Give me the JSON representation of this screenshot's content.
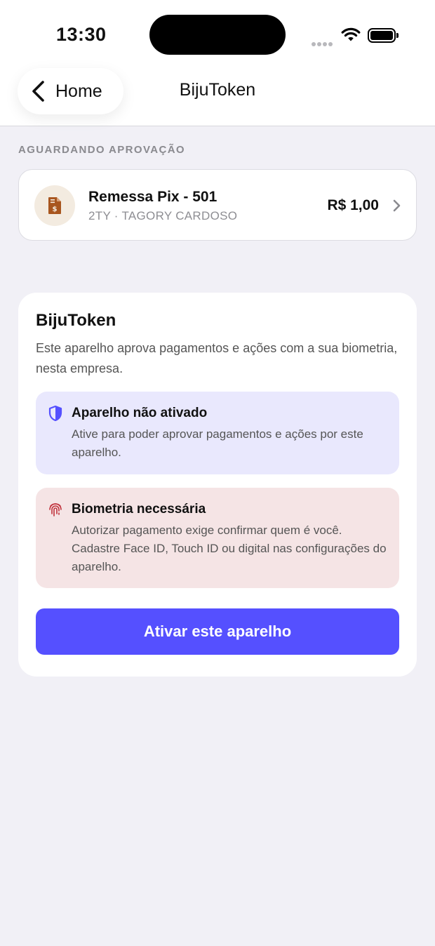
{
  "status_bar": {
    "time": "13:30"
  },
  "nav": {
    "back_label": "Home",
    "title": "BijuToken"
  },
  "pending": {
    "section_label": "AGUARDANDO APROVAÇÃO",
    "item": {
      "title": "Remessa Pix - 501",
      "subtitle": "2TY · TAGORY CARDOSO",
      "amount": "R$ 1,00"
    }
  },
  "token_card": {
    "title": "BijuToken",
    "description": "Este aparelho aprova pagamentos e ações com a sua biometria, nesta empresa.",
    "alerts": [
      {
        "title": "Aparelho não ativado",
        "text": "Ative para poder aprovar pagamentos e ações por este aparelho.",
        "icon": "shield-icon"
      },
      {
        "title": "Biometria necessária",
        "text": "Autorizar pagamento exige confirmar quem é você. Cadastre Face ID, Touch ID ou digital nas configurações do aparelho.",
        "icon": "fingerprint-icon"
      }
    ],
    "button_label": "Ativar este aparelho"
  },
  "colors": {
    "accent": "#5550ff",
    "alert_info_bg": "#e9e8fd",
    "alert_danger_bg": "#f5e4e5",
    "danger_icon": "#c0303a",
    "doc_icon": "#a8561f"
  }
}
